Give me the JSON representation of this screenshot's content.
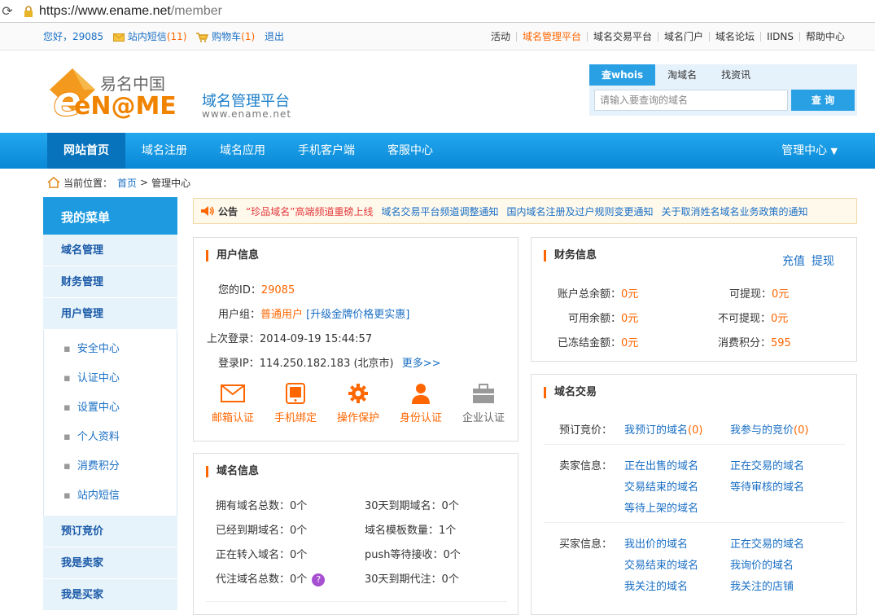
{
  "browser": {
    "url_base": "https://www.ename.net",
    "url_path": "/member"
  },
  "topbar": {
    "greeting": "您好，29085",
    "messages_label": "站内短信",
    "messages_count": "(11)",
    "cart_label": "购物车",
    "cart_count": "(1)",
    "logout": "退出",
    "links": [
      "活动",
      "域名管理平台",
      "域名交易平台",
      "域名门户",
      "域名论坛",
      "IIDNS",
      "帮助中心"
    ]
  },
  "header": {
    "logo_cn": "易名中国",
    "logo_en": "eN@ME",
    "platform": "域名管理平台",
    "site_url": "www.ename.net",
    "search_tabs": [
      "查whois",
      "淘域名",
      "找资讯"
    ],
    "search_placeholder": "请输入要查询的域名",
    "search_button": "查 询"
  },
  "nav": {
    "items": [
      "网站首页",
      "域名注册",
      "域名应用",
      "手机客户端",
      "客服中心"
    ],
    "manager": "管理中心"
  },
  "breadcrumb": {
    "label": "当前位置：",
    "home": "首页",
    "sep": ">",
    "current": "管理中心"
  },
  "sidebar": {
    "title": "我的菜单",
    "items_top": [
      "域名管理",
      "财务管理",
      "用户管理"
    ],
    "sub_items": [
      "安全中心",
      "认证中心",
      "设置中心",
      "个人资料",
      "消费积分",
      "站内短信"
    ],
    "items_bottom": [
      "预订竞价",
      "我是卖家",
      "我是买家"
    ]
  },
  "notice": {
    "label": "公告",
    "items": [
      "“珍品域名”高端频道重磅上线",
      "域名交易平台频道调整通知",
      "国内域名注册及过户规则变更通知",
      "关于取消姓名域名业务政策的通知"
    ]
  },
  "user_info": {
    "title": "用户信息",
    "id_label": "您的ID：",
    "id_value": "29085",
    "group_label": "用户组：",
    "group_value": "普通用户",
    "group_upgrade": "[升级金牌价格更实惠]",
    "last_login_label": "上次登录：",
    "last_login_value": "2014-09-19 15:44:57",
    "ip_label": "登录IP：",
    "ip_value": "114.250.182.183 (北京市)",
    "more": "更多>>",
    "verify": [
      "邮箱认证",
      "手机绑定",
      "操作保护",
      "身份认证",
      "企业认证"
    ]
  },
  "finance": {
    "title": "财务信息",
    "recharge": "充值",
    "withdraw": "提现",
    "total_label": "账户总余额：",
    "total_value": "0元",
    "withdrawable_label": "可提现：",
    "withdrawable_value": "0元",
    "available_label": "可用余额：",
    "available_value": "0元",
    "non_withdrawable_label": "不可提现：",
    "non_withdrawable_value": "0元",
    "frozen_label": "已冻结金额：",
    "frozen_value": "0元",
    "points_label": "消费积分：",
    "points_value": "595"
  },
  "domain_info": {
    "title": "域名信息",
    "total_label": "拥有域名总数：",
    "total_value": "0个",
    "expire30_label": "30天到期域名：",
    "expire30_value": "0个",
    "expired_label": "已经到期域名：",
    "expired_value": "0个",
    "template_label": "域名模板数量：",
    "template_value": "1个",
    "transfer_label": "正在转入域名：",
    "transfer_value": "0个",
    "push_label": "push等待接收：",
    "push_value": "0个",
    "proxy_label": "代注域名总数：",
    "proxy_value": "0个",
    "proxy30_label": "30天到期代注：",
    "proxy30_value": "0个",
    "help_icon": "?"
  },
  "trade": {
    "title": "域名交易",
    "presale_label": "预订竞价：",
    "presale_links": [
      "我预订的域名",
      "我参与的竞价"
    ],
    "presale_counts": [
      "(0)",
      "(0)"
    ],
    "seller_label": "卖家信息：",
    "seller_links": [
      "正在出售的域名",
      "正在交易的域名",
      "交易结束的域名",
      "等待审核的域名",
      "等待上架的域名"
    ],
    "buyer_label": "买家信息：",
    "buyer_links": [
      "我出价的域名",
      "正在交易的域名",
      "交易结束的域名",
      "我询价的域名",
      "我关注的域名",
      "我关注的店铺"
    ]
  },
  "colors": {
    "accent": "#ff6600",
    "brand_blue": "#1e9be0",
    "link": "#1a6fc4"
  }
}
